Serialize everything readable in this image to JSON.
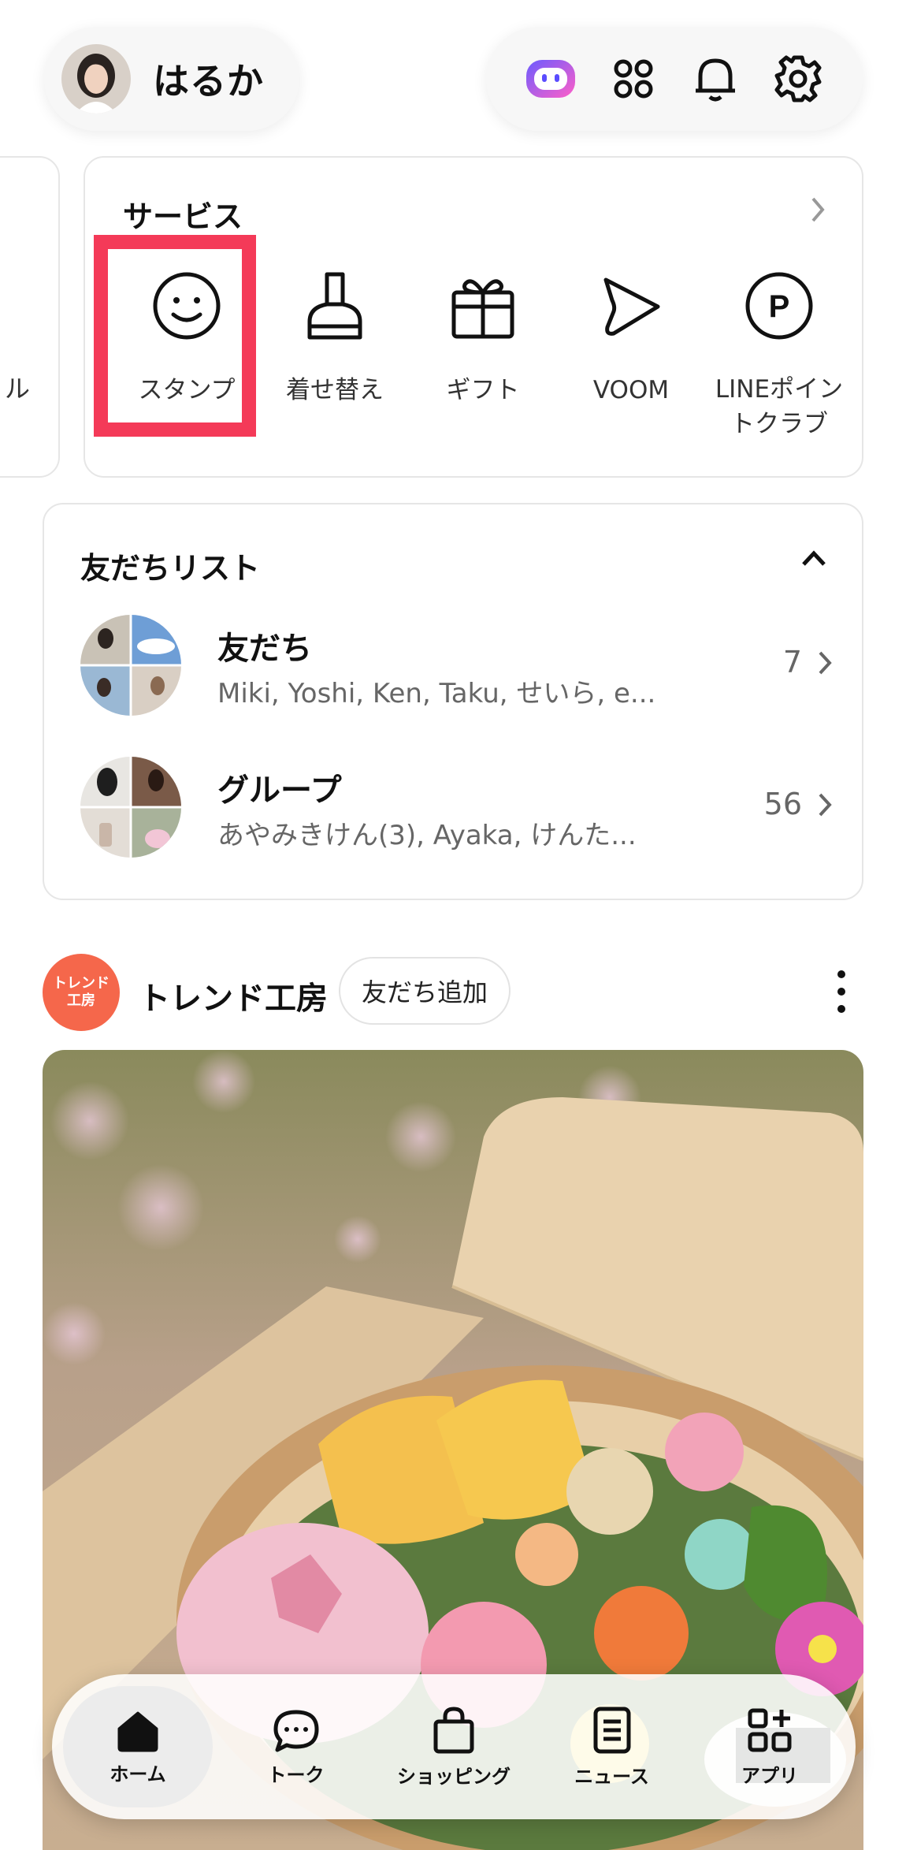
{
  "profile": {
    "name": "はるか"
  },
  "top_icons": [
    "ai-assistant-icon",
    "apps-grid-icon",
    "bell-icon",
    "gear-icon"
  ],
  "left_peek": {
    "text": "ル"
  },
  "services": {
    "title": "サービス",
    "items": [
      {
        "label": "スタンプ",
        "icon": "smiley-icon"
      },
      {
        "label": "着せ替え",
        "icon": "brush-icon"
      },
      {
        "label": "ギフト",
        "icon": "gift-icon"
      },
      {
        "label": "VOOM",
        "icon": "play-icon"
      },
      {
        "label": "LINEポイン\nトクラブ",
        "icon": "points-icon"
      }
    ]
  },
  "friends_list": {
    "title": "友だちリスト",
    "rows": [
      {
        "name": "友だち",
        "subtitle": "Miki, Yoshi, Ken, Taku, せいら, e...",
        "count": "7"
      },
      {
        "name": "グループ",
        "subtitle": "あやみきけん(3), Ayaka, けんた...",
        "count": "56"
      }
    ]
  },
  "official_account": {
    "logo_text": "トレンド\n工房",
    "name": "トレンド工房",
    "add_button": "友だち追加"
  },
  "bottom_nav": [
    {
      "label": "ホーム",
      "icon": "home-icon",
      "active": true
    },
    {
      "label": "トーク",
      "icon": "chat-icon",
      "active": false
    },
    {
      "label": "ショッピング",
      "icon": "shopping-bag-icon",
      "active": false
    },
    {
      "label": "ニュース",
      "icon": "news-icon",
      "active": false
    },
    {
      "label": "アプリ",
      "icon": "apps-add-icon",
      "active": false
    }
  ],
  "colors": {
    "highlight": "#f43a58",
    "oa_logo": "#f5674b",
    "ai_icon_gradient": [
      "#6b5cff",
      "#ff5fc8"
    ]
  }
}
